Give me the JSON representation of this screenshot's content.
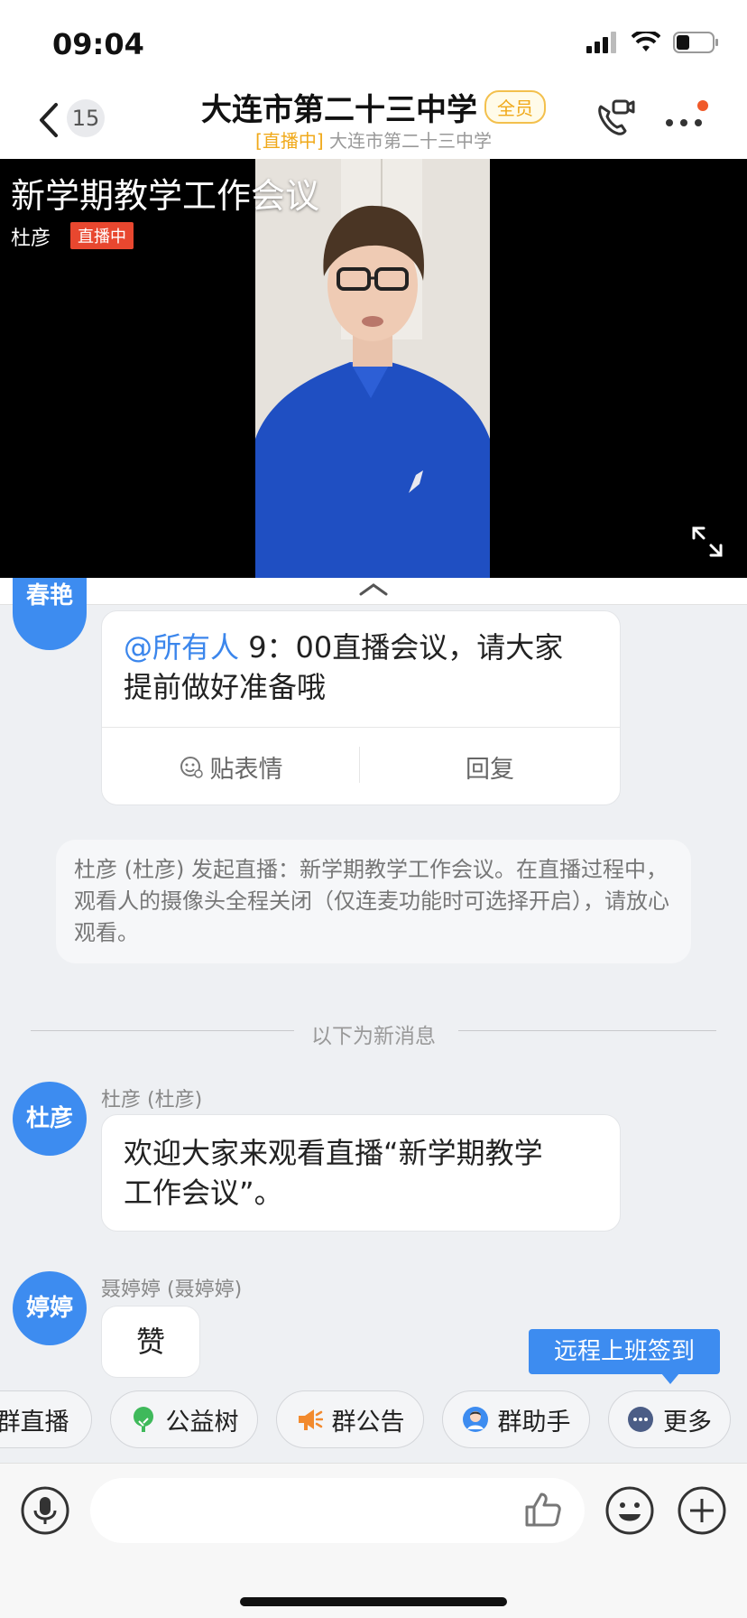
{
  "status_bar": {
    "time": "09:04"
  },
  "header": {
    "back_count": "15",
    "title": "大连市第二十三中学",
    "badge": "全员",
    "sub_tag": "[直播中]",
    "sub_text": "大连市第二十三中学"
  },
  "video": {
    "title": "新学期教学工作会议",
    "host": "杜彦",
    "live_label": "直播中"
  },
  "messages": {
    "m1": {
      "avatar": "春艳",
      "mention": "@所有人",
      "text_line1": " 9：00直播会议，请大家",
      "text_line2": "提前做好准备哦",
      "action_emoji": "贴表情",
      "action_reply": "回复"
    },
    "system_notice": "杜彦 (杜彦) 发起直播：新学期教学工作会议。在直播过程中，观看人的摄像头全程关闭（仅连麦功能时可选择开启），请放心观看。",
    "divider": "以下为新消息",
    "m2": {
      "avatar": "杜彦",
      "sender": "杜彦 (杜彦)",
      "text_line1": "欢迎大家来观看直播“新学期教学",
      "text_line2": "工作会议”。"
    },
    "m3": {
      "avatar": "婷婷",
      "sender": "聂婷婷 (聂婷婷)",
      "text": "赞"
    }
  },
  "checkin_tip": "远程上班签到",
  "quickbar": {
    "items": [
      {
        "label": "群直播",
        "icon": "live-icon"
      },
      {
        "label": "公益树",
        "icon": "tree-icon"
      },
      {
        "label": "群公告",
        "icon": "megaphone-icon"
      },
      {
        "label": "群助手",
        "icon": "assistant-icon"
      },
      {
        "label": "更多",
        "icon": "more-dots-icon"
      }
    ]
  },
  "input": {
    "placeholder": ""
  },
  "colors": {
    "accent": "#3d8cf0",
    "live_red": "#e8472f",
    "badge_gold": "#f0a91a"
  }
}
